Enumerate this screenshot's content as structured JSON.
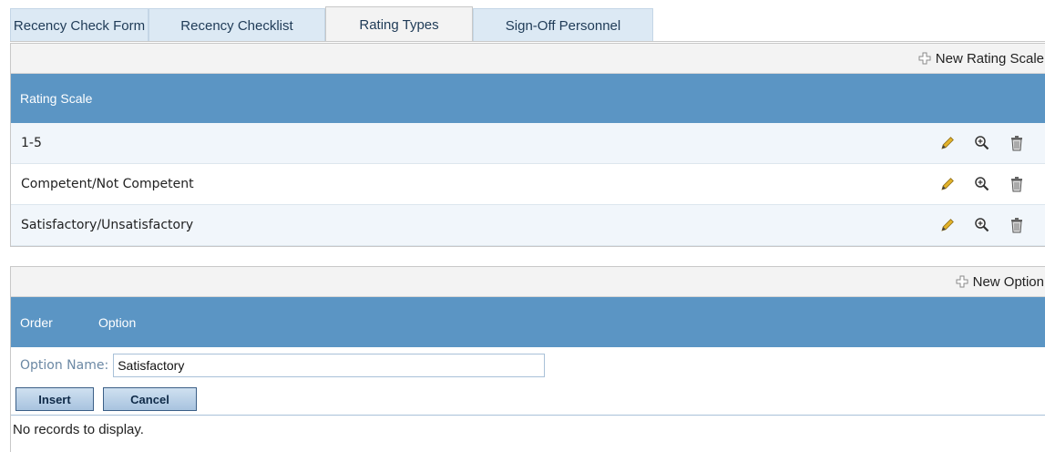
{
  "tabs": [
    {
      "label": "Recency Check Form",
      "active": false
    },
    {
      "label": "Recency Checklist",
      "active": false
    },
    {
      "label": "Rating Types",
      "active": true
    },
    {
      "label": "Sign-Off Personnel",
      "active": false
    }
  ],
  "scales_panel": {
    "new_label": "New Rating Scale",
    "header": "Rating Scale",
    "rows": [
      {
        "name": "1-5"
      },
      {
        "name": "Competent/Not Competent"
      },
      {
        "name": "Satisfactory/Unsatisfactory"
      }
    ]
  },
  "options_panel": {
    "new_label": "New Option",
    "header_order": "Order",
    "header_option": "Option",
    "form": {
      "label": "Option Name:",
      "value": "Satisfactory",
      "insert_label": "Insert",
      "cancel_label": "Cancel"
    },
    "empty_text": "No records to display."
  },
  "icons": {
    "new": "plus-icon",
    "edit": "pencil-icon",
    "view": "zoom-in-icon",
    "delete": "trash-icon"
  },
  "colors": {
    "header": "#5b95c4",
    "tab": "#dce9f4",
    "active_tab": "#f3f3f3"
  }
}
